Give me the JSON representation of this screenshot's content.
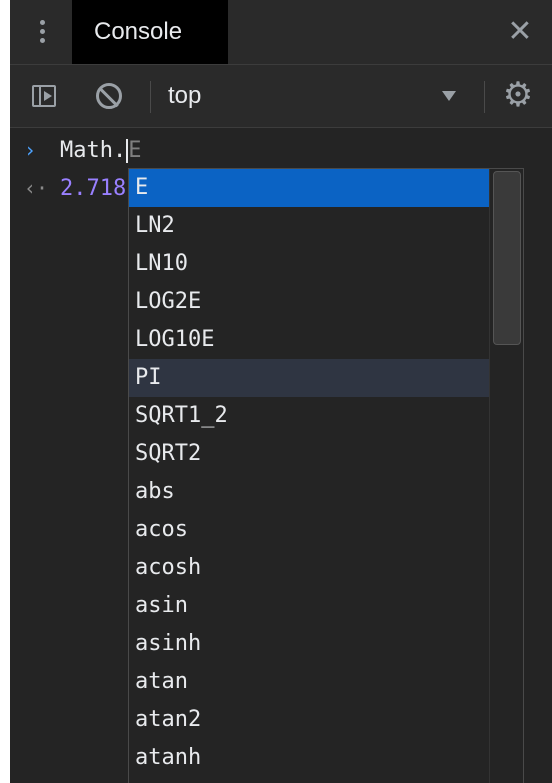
{
  "tabbar": {
    "active_tab": "Console",
    "close_symbol": "✕"
  },
  "toolbar": {
    "context": "top"
  },
  "console": {
    "prompt_symbol": "›",
    "input_text": "Math.",
    "ghost_completion": "E",
    "result_marker": "‹·",
    "result_value": "2.718"
  },
  "autocomplete": {
    "selected_index": 0,
    "hover_index": 5,
    "items": [
      "E",
      "LN2",
      "LN10",
      "LOG2E",
      "LOG10E",
      "PI",
      "SQRT1_2",
      "SQRT2",
      "abs",
      "acos",
      "acosh",
      "asin",
      "asinh",
      "atan",
      "atan2",
      "atanh"
    ]
  },
  "colors": {
    "selection": "#0b63c4",
    "prompt": "#4da3ff",
    "result": "#9980ff"
  },
  "icons": {
    "menu": "kebab-icon",
    "sidebar": "sidebar-toggle-icon",
    "clear": "clear-console-icon",
    "dropdown": "triangle-down-icon",
    "settings": "gear-icon",
    "close": "close-icon"
  }
}
